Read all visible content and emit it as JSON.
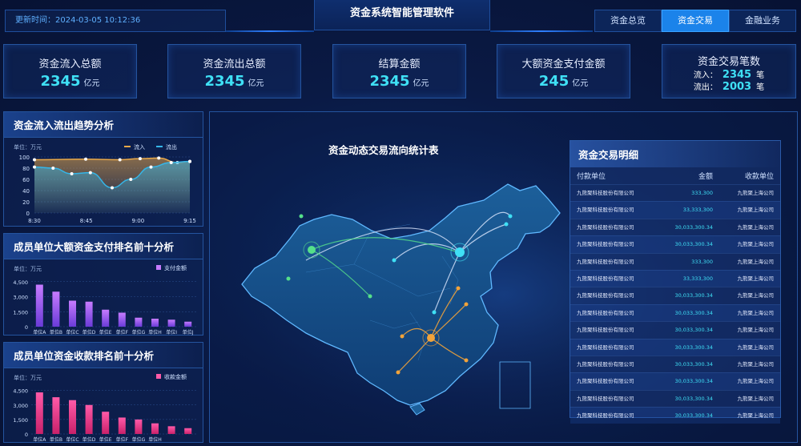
{
  "header": {
    "update_time": "更新时间：2024-03-05 10:12:36",
    "title": "资金系统智能管理软件",
    "tabs": [
      {
        "label": "资金总览",
        "active": false
      },
      {
        "label": "资金交易",
        "active": true
      },
      {
        "label": "金融业务",
        "active": false
      }
    ]
  },
  "kpis": [
    {
      "label": "资金流入总额",
      "value": "2345",
      "unit": "亿元"
    },
    {
      "label": "资金流出总额",
      "value": "2345",
      "unit": "亿元"
    },
    {
      "label": "结算金额",
      "value": "2345",
      "unit": "亿元"
    },
    {
      "label": "大额资金支付金额",
      "value": "245",
      "unit": "亿元"
    },
    {
      "label": "资金交易笔数",
      "inflow_label": "流入：",
      "inflow": "2345",
      "outflow_label": "流出：",
      "outflow": "2003",
      "unit": "笔"
    }
  ],
  "trend_panel": {
    "title": "资金流入流出趋势分析",
    "unit_label": "单位：万元",
    "chart_data": {
      "type": "area",
      "x": [
        "8:30",
        "8:45",
        "9:00",
        "9:15"
      ],
      "x_ticks": [
        "8:30",
        "8:45",
        "9:00",
        "9:15"
      ],
      "ylim": [
        0,
        100
      ],
      "y_ticks": [
        0,
        20,
        40,
        60,
        80,
        100
      ],
      "series": [
        {
          "name": "流入",
          "color": "#e7a84a",
          "points": [
            [
              0,
              95
            ],
            [
              0.33,
              96
            ],
            [
              0.55,
              95
            ],
            [
              0.68,
              97
            ],
            [
              0.8,
              98
            ],
            [
              0.92,
              90
            ],
            [
              1.0,
              92
            ]
          ]
        },
        {
          "name": "流出",
          "color": "#35b6e8",
          "points": [
            [
              0,
              82
            ],
            [
              0.12,
              80
            ],
            [
              0.24,
              70
            ],
            [
              0.36,
              72
            ],
            [
              0.5,
              45
            ],
            [
              0.62,
              60
            ],
            [
              0.75,
              82
            ],
            [
              0.88,
              90
            ],
            [
              1.0,
              92
            ]
          ]
        }
      ]
    }
  },
  "pay_panel": {
    "title": "成员单位大额资金支付排名前十分析",
    "unit_label": "单位：万元",
    "legend": "支付金额",
    "chart_data": {
      "type": "bar",
      "categories": [
        "单位A",
        "单位B",
        "单位C",
        "单位D",
        "单位E",
        "单位F",
        "单位G",
        "单位H",
        "单位I",
        "单位J"
      ],
      "tick_labels": [
        "单位A",
        "单位B",
        "单位C",
        "单位D",
        "单位E",
        "单位F",
        "单位G",
        "单位H",
        "单位I",
        "单位J"
      ],
      "values": [
        4200,
        3500,
        2600,
        2500,
        1700,
        1400,
        900,
        800,
        700,
        500
      ],
      "y_ticks": [
        0,
        1500,
        3000,
        4500
      ],
      "y_tick_labels": [
        "0",
        "1,500",
        "3,000",
        "4,500"
      ],
      "ylim": [
        0,
        4800
      ],
      "color_top": "#c77bff",
      "color_bottom": "#6a3bd8"
    }
  },
  "recv_panel": {
    "title": "成员单位资金收款排名前十分析",
    "unit_label": "单位：万元",
    "legend": "收款金额",
    "chart_data": {
      "type": "bar",
      "categories": [
        "单位A",
        "单位B",
        "单位C",
        "单位D",
        "单位E",
        "单位F",
        "单位G",
        "单位H"
      ],
      "tick_labels": [
        "单位A",
        "单位B",
        "单位C",
        "单位D",
        "单位E",
        "单位F",
        "单位G",
        "单位H"
      ],
      "values": [
        4300,
        3800,
        3500,
        3000,
        2300,
        1700,
        1500,
        1100,
        800,
        600
      ],
      "y_ticks": [
        0,
        1500,
        3000,
        4500
      ],
      "y_tick_labels": [
        "0",
        "1,500",
        "3,000",
        "4,500"
      ],
      "ylim": [
        0,
        4800
      ],
      "color_top": "#ff5aa8",
      "color_bottom": "#c9216a"
    }
  },
  "map": {
    "title": "资金动态交易流向统计表"
  },
  "table": {
    "title": "资金交易明细",
    "headers": [
      "付款单位",
      "金额",
      "收款单位"
    ],
    "rows": [
      [
        "九熊聚科技股份有限公司",
        "333,300",
        "九熊聚上海公司"
      ],
      [
        "九熊聚科技股份有限公司",
        "33,333,300",
        "九熊聚上海公司"
      ],
      [
        "九熊聚科技股份有限公司",
        "30,033,300.34",
        "九熊聚上海公司"
      ],
      [
        "九熊聚科技股份有限公司",
        "30,033,300.34",
        "九熊聚上海公司"
      ],
      [
        "九熊聚科技股份有限公司",
        "333,300",
        "九熊聚上海公司"
      ],
      [
        "九熊聚科技股份有限公司",
        "33,333,300",
        "九熊聚上海公司"
      ],
      [
        "九熊聚科技股份有限公司",
        "30,033,300.34",
        "九熊聚上海公司"
      ],
      [
        "九熊聚科技股份有限公司",
        "30,033,300.34",
        "九熊聚上海公司"
      ],
      [
        "九熊聚科技股份有限公司",
        "30,033,300.34",
        "九熊聚上海公司"
      ],
      [
        "九熊聚科技股份有限公司",
        "30,033,300.34",
        "九熊聚上海公司"
      ],
      [
        "九熊聚科技股份有限公司",
        "30,033,300.34",
        "九熊聚上海公司"
      ],
      [
        "九熊聚科技股份有限公司",
        "30,033,300.34",
        "九熊聚上海公司"
      ],
      [
        "九熊聚科技股份有限公司",
        "30,033,300.34",
        "九熊聚上海公司"
      ],
      [
        "九熊聚科技股份有限公司",
        "30,033,300.34",
        "九熊聚上海公司"
      ]
    ]
  }
}
